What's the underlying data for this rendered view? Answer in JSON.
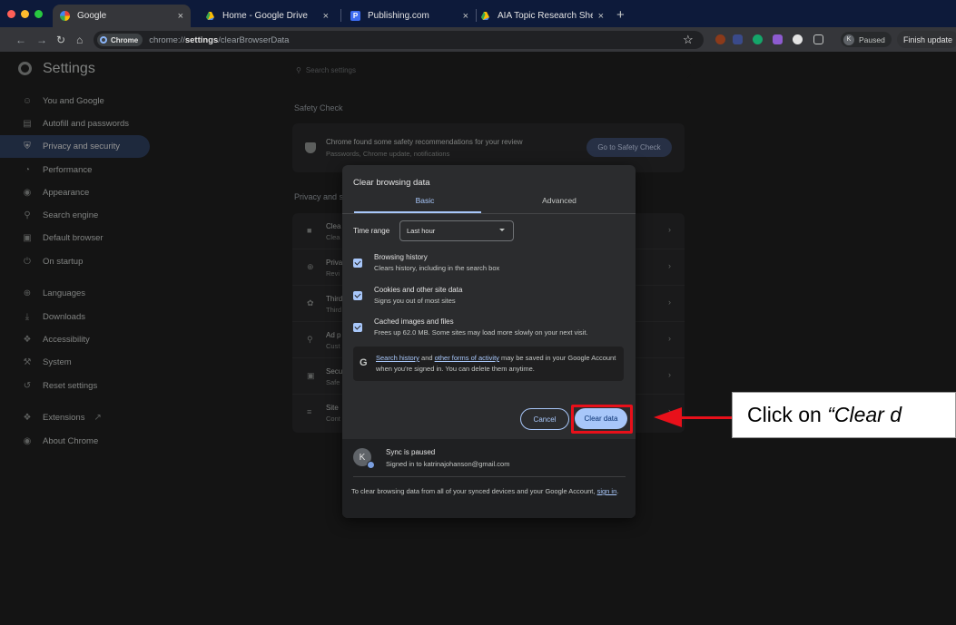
{
  "tabs": [
    {
      "title": "Google",
      "icon": "google-favicon",
      "active": true
    },
    {
      "title": "Home - Google Drive",
      "icon": "drive-favicon",
      "active": false
    },
    {
      "title": "Publishing.com",
      "icon": "publishing-favicon",
      "active": false
    },
    {
      "title": "AIA Topic Research Sheet - M",
      "icon": "drive-favicon",
      "active": false
    }
  ],
  "toolbar": {
    "chip_label": "Chrome",
    "url_prefix": "chrome://",
    "url_bold": "settings",
    "url_rest": "/clearBrowserData",
    "profile_initial": "K",
    "profile_status": "Paused",
    "finish_update_label": "Finish update"
  },
  "settings": {
    "title": "Settings",
    "search_placeholder": "Search settings",
    "nav": [
      {
        "label": "You and Google",
        "icon": "person-icon"
      },
      {
        "label": "Autofill and passwords",
        "icon": "clipboard-icon"
      },
      {
        "label": "Privacy and security",
        "icon": "shield-icon",
        "active": true
      },
      {
        "label": "Performance",
        "icon": "speedometer-icon"
      },
      {
        "label": "Appearance",
        "icon": "palette-icon"
      },
      {
        "label": "Search engine",
        "icon": "search-icon"
      },
      {
        "label": "Default browser",
        "icon": "browser-icon"
      },
      {
        "label": "On startup",
        "icon": "power-icon"
      },
      {
        "label": "Languages",
        "icon": "globe-icon"
      },
      {
        "label": "Downloads",
        "icon": "download-icon"
      },
      {
        "label": "Accessibility",
        "icon": "accessibility-icon"
      },
      {
        "label": "System",
        "icon": "wrench-icon"
      },
      {
        "label": "Reset settings",
        "icon": "reset-icon"
      },
      {
        "label": "Extensions",
        "icon": "puzzle-icon"
      },
      {
        "label": "About Chrome",
        "icon": "chrome-icon"
      }
    ],
    "safety_check": {
      "heading": "Safety Check",
      "line1": "Chrome found some safety recommendations for your review",
      "line2": "Passwords, Chrome update, notifications",
      "button": "Go to Safety Check"
    },
    "privacy_heading": "Privacy and s",
    "privacy_rows": [
      {
        "t1": "Clea",
        "t2": "Clea",
        "icon": "trash-icon"
      },
      {
        "t1": "Priva",
        "t2": "Revi",
        "icon": "compass-icon"
      },
      {
        "t1": "Third",
        "t2": "Third",
        "icon": "cookie-icon"
      },
      {
        "t1": "Ad p",
        "t2": "Cust",
        "icon": "ad-icon"
      },
      {
        "t1": "Secu",
        "t2": "Safe",
        "icon": "lock-icon"
      },
      {
        "t1": "Site",
        "t2": "Cont",
        "icon": "sliders-icon"
      }
    ]
  },
  "dialog": {
    "title": "Clear browsing data",
    "tab_basic": "Basic",
    "tab_advanced": "Advanced",
    "time_range_label": "Time range",
    "time_range_value": "Last hour",
    "options": [
      {
        "title": "Browsing history",
        "desc": "Clears history, including in the search box",
        "checked": true
      },
      {
        "title": "Cookies and other site data",
        "desc": "Signs you out of most sites",
        "checked": true
      },
      {
        "title": "Cached images and files",
        "desc": "Frees up 62.0 MB. Some sites may load more slowly on your next visit.",
        "checked": true
      }
    ],
    "google_note": {
      "link1": "Search history",
      "mid1": " and ",
      "link2": "other forms of activity",
      "rest": " may be saved in your Google Account when you're signed in. You can delete them anytime."
    },
    "cancel_label": "Cancel",
    "clear_label": "Clear data",
    "sync_initial": "K",
    "sync_title": "Sync is paused",
    "sync_desc": "Signed in to katrinajohanson@gmail.com",
    "footer_text": "To clear browsing data from all of your synced devices and your Google Account, ",
    "footer_link": "sign in",
    "footer_end": "."
  },
  "annotation": {
    "prefix": "Click on ",
    "emph": "“Clear d"
  },
  "colors": {
    "accent": "#a8c7fa",
    "highlight": "#e8101a",
    "tabstrip": "#0d1a3a"
  }
}
